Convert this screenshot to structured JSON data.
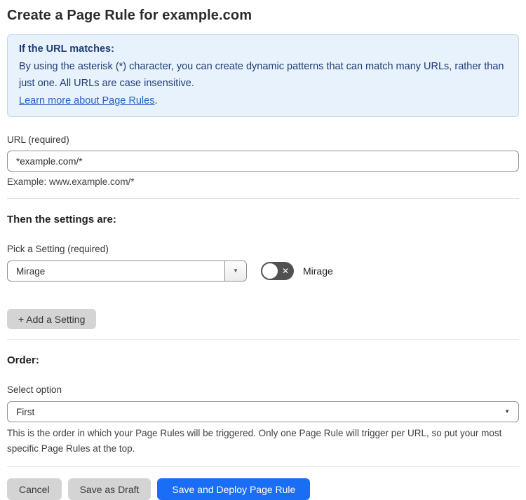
{
  "page": {
    "title": "Create a Page Rule for example.com"
  },
  "info_box": {
    "heading": "If the URL matches:",
    "body": "By using the asterisk (*) character, you can create dynamic patterns that can match many URLs, rather than just one. All URLs are case insensitive.",
    "link_label": "Learn more about Page Rules",
    "link_suffix": "."
  },
  "url_field": {
    "label": "URL (required)",
    "value": "*example.com/*",
    "helper": "Example: www.example.com/*"
  },
  "settings_section": {
    "heading": "Then the settings are:",
    "setting_label": "Pick a Setting (required)",
    "setting_value": "Mirage",
    "toggle_label": "Mirage",
    "toggle_state": "off",
    "add_setting_label": "+ Add a Setting"
  },
  "order_section": {
    "heading": "Order:",
    "label": "Select option",
    "value": "First",
    "helper": "This is the order in which your Page Rules will be triggered. Only one Page Rule will trigger per URL, so put your most specific Page Rules at the top."
  },
  "footer": {
    "cancel_label": "Cancel",
    "save_draft_label": "Save as Draft",
    "save_deploy_label": "Save and Deploy Page Rule"
  },
  "icons": {
    "dropdown_caret": "▼",
    "toggle_off_glyph": "✕"
  },
  "colors": {
    "accent_blue": "#1a6ef5",
    "info_background": "#e8f2fc",
    "info_border": "#bcd9f1",
    "info_text": "#1d3c78",
    "link_blue": "#2962c4",
    "button_gray": "#d4d4d4",
    "toggle_track": "#4f5153"
  }
}
